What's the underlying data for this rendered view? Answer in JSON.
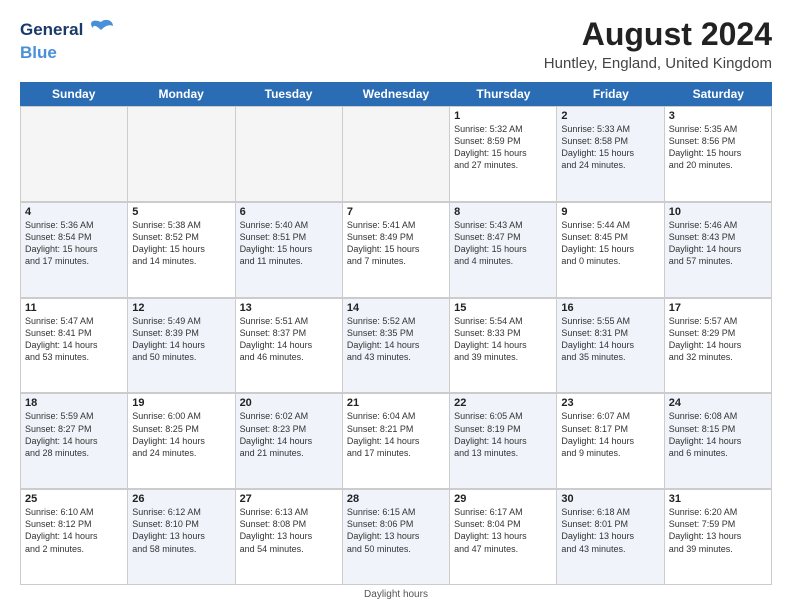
{
  "header": {
    "logo_line1": "General",
    "logo_line2": "Blue",
    "month_title": "August 2024",
    "location": "Huntley, England, United Kingdom"
  },
  "weekdays": [
    "Sunday",
    "Monday",
    "Tuesday",
    "Wednesday",
    "Thursday",
    "Friday",
    "Saturday"
  ],
  "footer": "Daylight hours",
  "rows": [
    [
      {
        "day": "",
        "empty": true
      },
      {
        "day": "",
        "empty": true
      },
      {
        "day": "",
        "empty": true
      },
      {
        "day": "",
        "empty": true
      },
      {
        "day": "1",
        "info": "Sunrise: 5:32 AM\nSunset: 8:59 PM\nDaylight: 15 hours\nand 27 minutes.",
        "shaded": false
      },
      {
        "day": "2",
        "info": "Sunrise: 5:33 AM\nSunset: 8:58 PM\nDaylight: 15 hours\nand 24 minutes.",
        "shaded": true
      },
      {
        "day": "3",
        "info": "Sunrise: 5:35 AM\nSunset: 8:56 PM\nDaylight: 15 hours\nand 20 minutes.",
        "shaded": false
      }
    ],
    [
      {
        "day": "4",
        "info": "Sunrise: 5:36 AM\nSunset: 8:54 PM\nDaylight: 15 hours\nand 17 minutes.",
        "shaded": true
      },
      {
        "day": "5",
        "info": "Sunrise: 5:38 AM\nSunset: 8:52 PM\nDaylight: 15 hours\nand 14 minutes.",
        "shaded": false
      },
      {
        "day": "6",
        "info": "Sunrise: 5:40 AM\nSunset: 8:51 PM\nDaylight: 15 hours\nand 11 minutes.",
        "shaded": true
      },
      {
        "day": "7",
        "info": "Sunrise: 5:41 AM\nSunset: 8:49 PM\nDaylight: 15 hours\nand 7 minutes.",
        "shaded": false
      },
      {
        "day": "8",
        "info": "Sunrise: 5:43 AM\nSunset: 8:47 PM\nDaylight: 15 hours\nand 4 minutes.",
        "shaded": true
      },
      {
        "day": "9",
        "info": "Sunrise: 5:44 AM\nSunset: 8:45 PM\nDaylight: 15 hours\nand 0 minutes.",
        "shaded": false
      },
      {
        "day": "10",
        "info": "Sunrise: 5:46 AM\nSunset: 8:43 PM\nDaylight: 14 hours\nand 57 minutes.",
        "shaded": true
      }
    ],
    [
      {
        "day": "11",
        "info": "Sunrise: 5:47 AM\nSunset: 8:41 PM\nDaylight: 14 hours\nand 53 minutes.",
        "shaded": false
      },
      {
        "day": "12",
        "info": "Sunrise: 5:49 AM\nSunset: 8:39 PM\nDaylight: 14 hours\nand 50 minutes.",
        "shaded": true
      },
      {
        "day": "13",
        "info": "Sunrise: 5:51 AM\nSunset: 8:37 PM\nDaylight: 14 hours\nand 46 minutes.",
        "shaded": false
      },
      {
        "day": "14",
        "info": "Sunrise: 5:52 AM\nSunset: 8:35 PM\nDaylight: 14 hours\nand 43 minutes.",
        "shaded": true
      },
      {
        "day": "15",
        "info": "Sunrise: 5:54 AM\nSunset: 8:33 PM\nDaylight: 14 hours\nand 39 minutes.",
        "shaded": false
      },
      {
        "day": "16",
        "info": "Sunrise: 5:55 AM\nSunset: 8:31 PM\nDaylight: 14 hours\nand 35 minutes.",
        "shaded": true
      },
      {
        "day": "17",
        "info": "Sunrise: 5:57 AM\nSunset: 8:29 PM\nDaylight: 14 hours\nand 32 minutes.",
        "shaded": false
      }
    ],
    [
      {
        "day": "18",
        "info": "Sunrise: 5:59 AM\nSunset: 8:27 PM\nDaylight: 14 hours\nand 28 minutes.",
        "shaded": true
      },
      {
        "day": "19",
        "info": "Sunrise: 6:00 AM\nSunset: 8:25 PM\nDaylight: 14 hours\nand 24 minutes.",
        "shaded": false
      },
      {
        "day": "20",
        "info": "Sunrise: 6:02 AM\nSunset: 8:23 PM\nDaylight: 14 hours\nand 21 minutes.",
        "shaded": true
      },
      {
        "day": "21",
        "info": "Sunrise: 6:04 AM\nSunset: 8:21 PM\nDaylight: 14 hours\nand 17 minutes.",
        "shaded": false
      },
      {
        "day": "22",
        "info": "Sunrise: 6:05 AM\nSunset: 8:19 PM\nDaylight: 14 hours\nand 13 minutes.",
        "shaded": true
      },
      {
        "day": "23",
        "info": "Sunrise: 6:07 AM\nSunset: 8:17 PM\nDaylight: 14 hours\nand 9 minutes.",
        "shaded": false
      },
      {
        "day": "24",
        "info": "Sunrise: 6:08 AM\nSunset: 8:15 PM\nDaylight: 14 hours\nand 6 minutes.",
        "shaded": true
      }
    ],
    [
      {
        "day": "25",
        "info": "Sunrise: 6:10 AM\nSunset: 8:12 PM\nDaylight: 14 hours\nand 2 minutes.",
        "shaded": false
      },
      {
        "day": "26",
        "info": "Sunrise: 6:12 AM\nSunset: 8:10 PM\nDaylight: 13 hours\nand 58 minutes.",
        "shaded": true
      },
      {
        "day": "27",
        "info": "Sunrise: 6:13 AM\nSunset: 8:08 PM\nDaylight: 13 hours\nand 54 minutes.",
        "shaded": false
      },
      {
        "day": "28",
        "info": "Sunrise: 6:15 AM\nSunset: 8:06 PM\nDaylight: 13 hours\nand 50 minutes.",
        "shaded": true
      },
      {
        "day": "29",
        "info": "Sunrise: 6:17 AM\nSunset: 8:04 PM\nDaylight: 13 hours\nand 47 minutes.",
        "shaded": false
      },
      {
        "day": "30",
        "info": "Sunrise: 6:18 AM\nSunset: 8:01 PM\nDaylight: 13 hours\nand 43 minutes.",
        "shaded": true
      },
      {
        "day": "31",
        "info": "Sunrise: 6:20 AM\nSunset: 7:59 PM\nDaylight: 13 hours\nand 39 minutes.",
        "shaded": false
      }
    ]
  ]
}
